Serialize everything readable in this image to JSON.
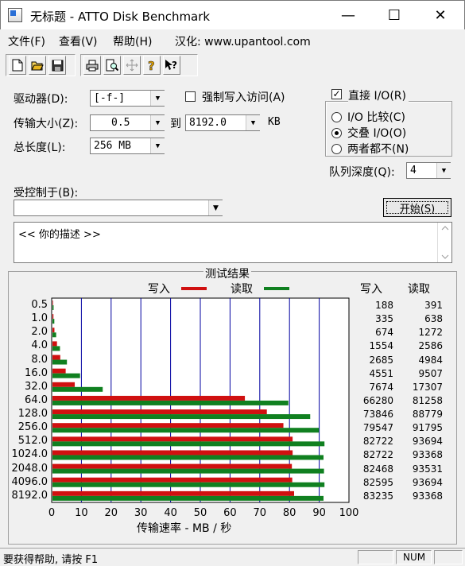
{
  "window": {
    "title": "无标题 - ATTO Disk Benchmark",
    "minimize": "—",
    "maximize": "☐",
    "close": "✕"
  },
  "menu": {
    "file": "文件(F)",
    "view": "查看(V)",
    "help": "帮助(H)",
    "localized": "汉化: www.upantool.com"
  },
  "toolbar": {
    "icons": [
      "new-file-icon",
      "open-icon",
      "save-icon",
      "print-icon",
      "print-preview-icon",
      "move-icon",
      "help-icon",
      "context-help-icon"
    ]
  },
  "form": {
    "drive_label": "驱动器(D):",
    "drive_value": "[-f-]",
    "force_write_label": "强制写入访问(A)",
    "transfer_label": "传输大小(Z):",
    "transfer_from": "0.5",
    "transfer_to_label": "到",
    "transfer_to": "8192.0",
    "transfer_unit": "KB",
    "length_label": "总长度(L):",
    "length_value": "256 MB",
    "direct_io_label": "直接 I/O(R)",
    "direct_io_checked": true,
    "io_compare_label": "I/O 比较(C)",
    "overlap_io_label": "交叠 I/O(O)",
    "neither_label": "两者都不(N)",
    "queue_depth_label": "队列深度(Q):",
    "queue_depth_value": "4",
    "controlled_by_label": "受控制于(B):",
    "controlled_by_value": "",
    "start_button": "开始(S)",
    "description": "<<  你的描述   >>"
  },
  "results": {
    "title": "测试结果",
    "legend_write": "写入",
    "legend_read": "读取",
    "col_write": "写入",
    "col_read": "读取",
    "xlabel": "传输速率 - MB / 秒",
    "colors": {
      "write": "#d01010",
      "read": "#108020",
      "grid": "#0000a0"
    }
  },
  "chart_data": {
    "type": "bar",
    "orientation": "horizontal",
    "categories": [
      "0.5",
      "1.0",
      "2.0",
      "4.0",
      "8.0",
      "16.0",
      "32.0",
      "64.0",
      "128.0",
      "256.0",
      "512.0",
      "1024.0",
      "2048.0",
      "4096.0",
      "8192.0"
    ],
    "series": [
      {
        "name": "写入",
        "values": [
          188,
          335,
          674,
          1554,
          2685,
          4551,
          7674,
          66280,
          73846,
          79547,
          82722,
          82722,
          82468,
          82595,
          83235
        ]
      },
      {
        "name": "读取",
        "values": [
          391,
          638,
          1272,
          2586,
          4984,
          9507,
          17307,
          81258,
          88779,
          91795,
          93694,
          93368,
          93531,
          93694,
          93368
        ]
      }
    ],
    "xticks": [
      "0",
      "10",
      "20",
      "30",
      "40",
      "50",
      "60",
      "70",
      "80",
      "90",
      "100"
    ],
    "xlim": [
      0,
      100
    ],
    "xlabel": "传输速率 - MB / 秒"
  },
  "status": {
    "text": "要获得帮助, 请按 F1",
    "indicator": "NUM"
  }
}
